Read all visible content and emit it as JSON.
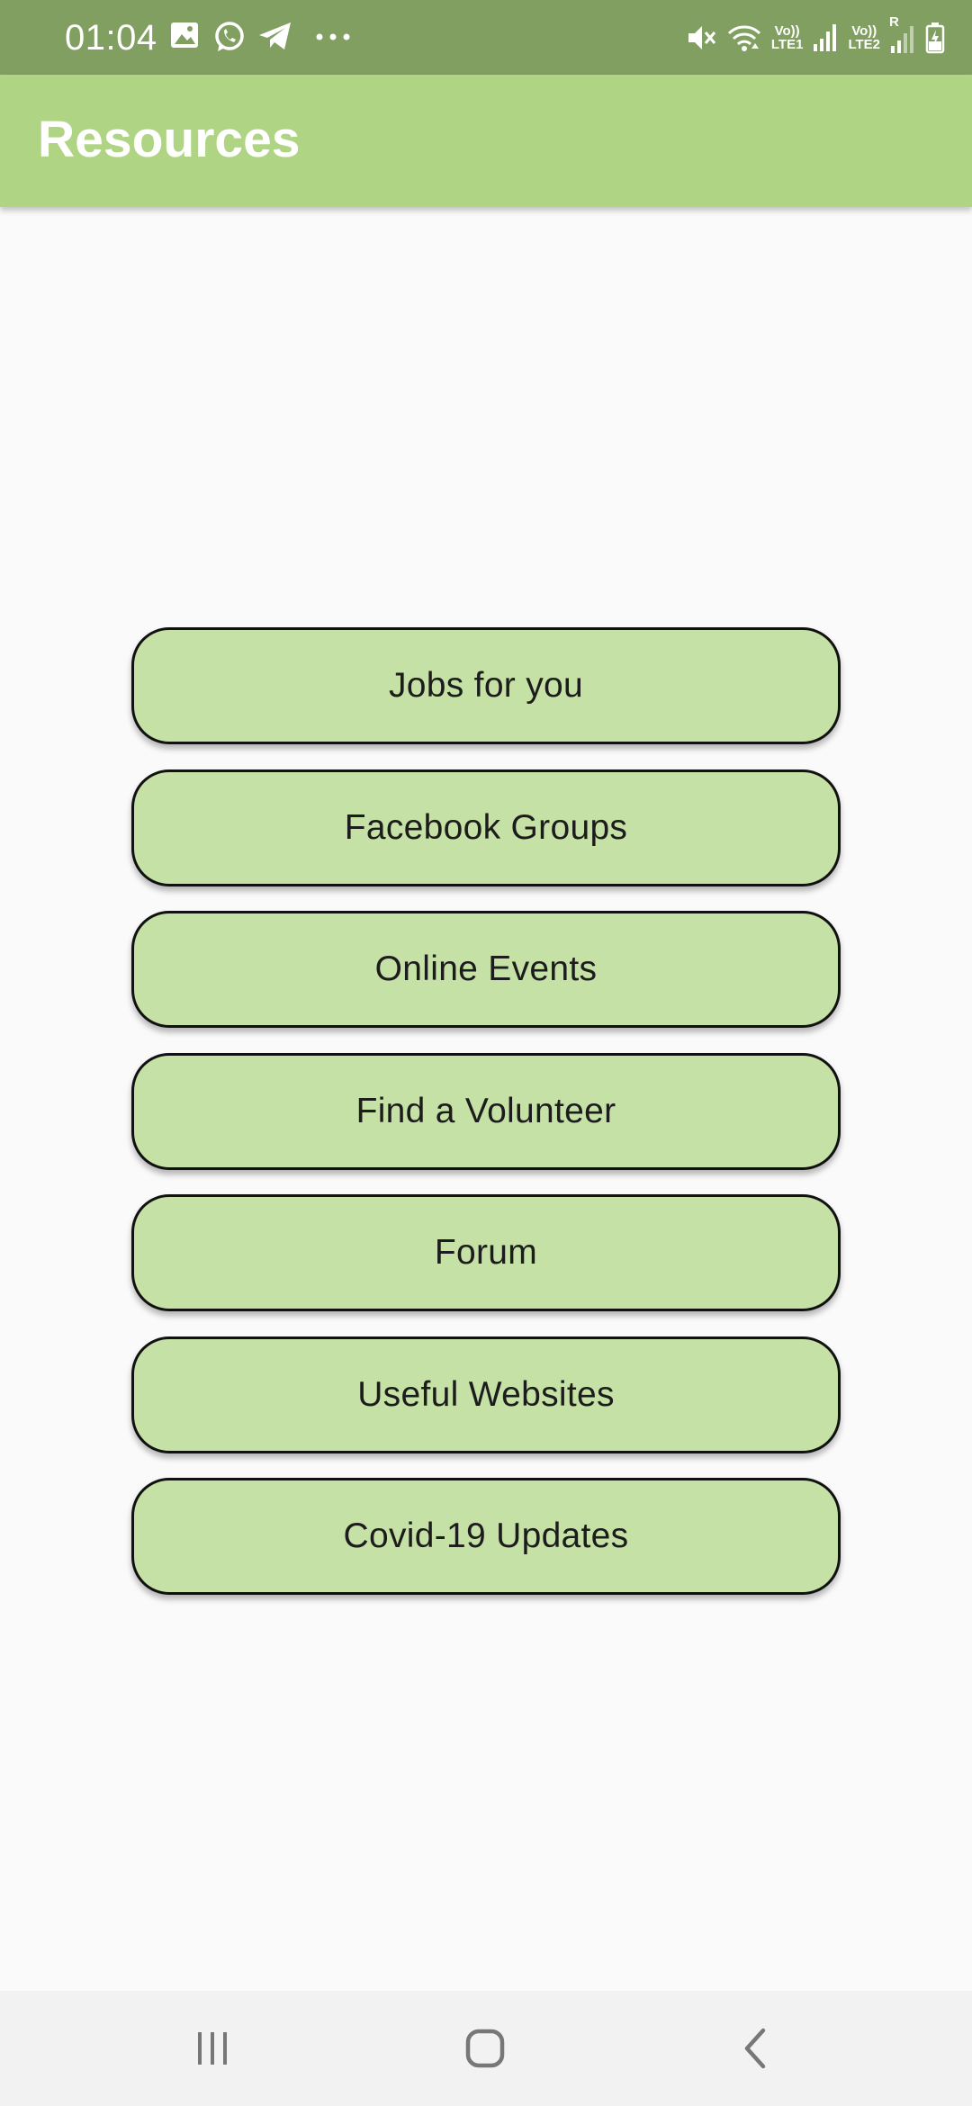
{
  "status_bar": {
    "time": "01:04",
    "sim1_label_top": "Vo))",
    "sim1_label_bottom": "LTE1",
    "sim2_label_top": "Vo))",
    "sim2_label_bottom": "LTE2",
    "roaming_label": "R",
    "left_icons": [
      "gallery-icon",
      "whatsapp-icon",
      "telegram-icon",
      "more-dots-icon"
    ],
    "right_icons": [
      "mute-icon",
      "wifi-icon",
      "signal-icon",
      "signal-icon",
      "battery-charging-icon"
    ]
  },
  "app_bar": {
    "title": "Resources"
  },
  "menu": {
    "items": [
      {
        "label": "Jobs for you"
      },
      {
        "label": "Facebook Groups"
      },
      {
        "label": "Online Events"
      },
      {
        "label": "Find a Volunteer"
      },
      {
        "label": "Forum"
      },
      {
        "label": "Useful Websites"
      },
      {
        "label": "Covid-19 Updates"
      }
    ]
  },
  "nav_bar": {
    "icons": [
      "recent-apps-icon",
      "home-icon",
      "back-icon"
    ]
  },
  "colors": {
    "status_bar": "#819f60",
    "app_bar": "#afd584",
    "button_fill": "#c5e1a5",
    "button_border": "#111111",
    "background": "#fafafa",
    "nav_bar": "#f2f2f2"
  }
}
